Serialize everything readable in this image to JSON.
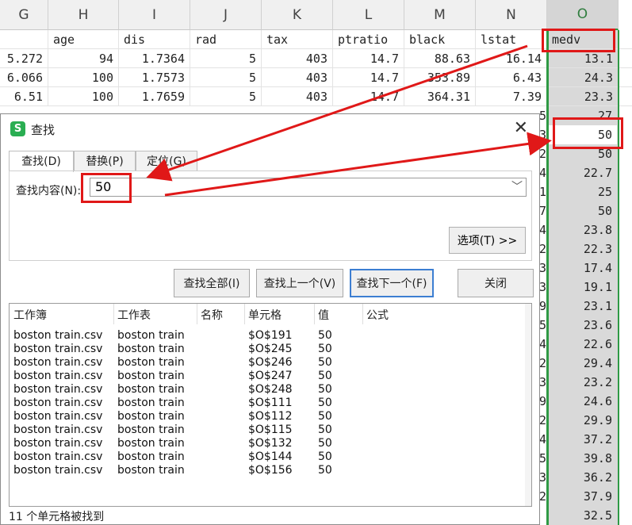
{
  "sheet": {
    "col_letters": [
      "G",
      "H",
      "I",
      "J",
      "K",
      "L",
      "M",
      "N",
      "O"
    ],
    "header_row": [
      "",
      "age",
      "dis",
      "rad",
      "tax",
      "ptratio",
      "black",
      "lstat",
      "medv"
    ],
    "rows": [
      [
        "5.272",
        "94",
        "1.7364",
        "5",
        "403",
        "14.7",
        "88.63",
        "16.14",
        "13.1"
      ],
      [
        "6.066",
        "100",
        "1.7573",
        "5",
        "403",
        "14.7",
        "353.89",
        "6.43",
        "24.3"
      ],
      [
        "6.51",
        "100",
        "1.7659",
        "5",
        "403",
        "14.7",
        "364.31",
        "7.39",
        "23.3"
      ]
    ],
    "medv_below": [
      "27",
      "50",
      "50",
      "22.7",
      "25",
      "50",
      "23.8",
      "22.3",
      "17.4",
      "19.1",
      "23.1",
      "23.6",
      "22.6",
      "29.4",
      "23.2",
      "24.6",
      "29.9",
      "37.2",
      "39.8",
      "36.2",
      "37.9",
      "32.5"
    ],
    "row_frag_n": [
      "5",
      "3",
      "2",
      "4",
      "1",
      "7",
      "4",
      "2",
      "3",
      "3",
      "9",
      "5",
      "4",
      "2",
      "3",
      "9",
      "2",
      "4",
      "5",
      "3",
      "2"
    ]
  },
  "dialog": {
    "icon_letter": "S",
    "title": "查找",
    "close_glyph": "✕",
    "tabs": [
      {
        "label": "查找(D)",
        "active": true
      },
      {
        "label": "替换(P)",
        "active": false
      },
      {
        "label": "定位(G)",
        "active": false
      }
    ],
    "find_label": "查找内容(N):",
    "find_value": "50",
    "dropdown_glyph": "﹀",
    "options_button": "选项(T) >>",
    "buttons": {
      "find_all": "查找全部(I)",
      "find_prev": "查找上一个(V)",
      "find_next": "查找下一个(F)",
      "close": "关闭"
    },
    "results": {
      "headers": [
        "工作簿",
        "工作表",
        "名称",
        "单元格",
        "值",
        "公式"
      ],
      "rows": [
        [
          "boston train.csv",
          "boston train",
          "",
          "$O$191",
          "50",
          ""
        ],
        [
          "boston train.csv",
          "boston train",
          "",
          "$O$245",
          "50",
          ""
        ],
        [
          "boston train.csv",
          "boston train",
          "",
          "$O$246",
          "50",
          ""
        ],
        [
          "boston train.csv",
          "boston train",
          "",
          "$O$247",
          "50",
          ""
        ],
        [
          "boston train.csv",
          "boston train",
          "",
          "$O$248",
          "50",
          ""
        ],
        [
          "boston train.csv",
          "boston train",
          "",
          "$O$111",
          "50",
          ""
        ],
        [
          "boston train.csv",
          "boston train",
          "",
          "$O$112",
          "50",
          ""
        ],
        [
          "boston train.csv",
          "boston train",
          "",
          "$O$115",
          "50",
          ""
        ],
        [
          "boston train.csv",
          "boston train",
          "",
          "$O$132",
          "50",
          ""
        ],
        [
          "boston train.csv",
          "boston train",
          "",
          "$O$144",
          "50",
          ""
        ],
        [
          "boston train.csv",
          "boston train",
          "",
          "$O$156",
          "50",
          ""
        ]
      ]
    },
    "status": "11 个单元格被找到"
  },
  "colors": {
    "accent_green": "#2f9a45",
    "annotation_red": "#e01818",
    "button_focus": "#3c7ed2"
  }
}
